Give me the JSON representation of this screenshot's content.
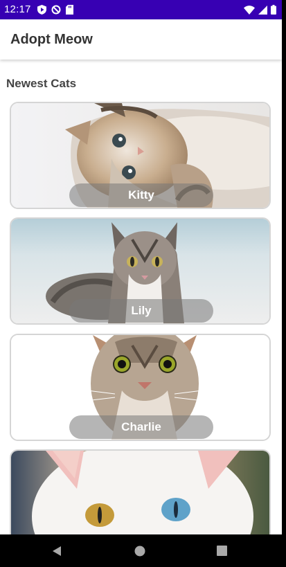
{
  "status_bar": {
    "time": "12:17",
    "left_icons": [
      "play-protect-icon",
      "data-saver-icon",
      "sd-card-icon"
    ],
    "right_icons": [
      "wifi-icon",
      "signal-icon",
      "battery-icon"
    ],
    "color": "#3700b3"
  },
  "app_bar": {
    "title": "Adopt Meow"
  },
  "section": {
    "title": "Newest Cats"
  },
  "cats": [
    {
      "name": "Kitty"
    },
    {
      "name": "Lily"
    },
    {
      "name": "Charlie"
    },
    {
      "name": ""
    }
  ],
  "nav": {
    "buttons": [
      "back-icon",
      "home-icon",
      "recents-icon"
    ]
  }
}
